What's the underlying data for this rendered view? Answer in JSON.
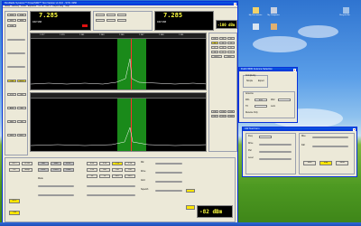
{
  "main_window": {
    "title": "FlexRadio Systems™ PowerSDR™ Text Version v1.19.0 - SVN: 1950",
    "menu": [
      "Setup",
      "Memory",
      "Wave",
      "Equalizer",
      "XVTR",
      "CW X",
      "Report Bug",
      "Help"
    ],
    "vfo_a": {
      "freq": "7.285",
      "freq_small": "000",
      "mode": "40M SSB"
    },
    "vfo_b": {
      "freq": "7.285",
      "freq_small": "000",
      "mode": "40M SSB"
    },
    "signal": "-100 dBm",
    "signal2": "-82 dBm",
    "ticks": [
      "7.277",
      "7.279",
      "7.281",
      "7.283",
      "7.285",
      "7.287",
      "7.289",
      "7.291",
      "7.293"
    ],
    "buttons_left": [
      "Start",
      "Stop",
      "Rec",
      "Mon",
      "Play",
      "TUN",
      "MOX",
      "VOX",
      "NR",
      "ANF",
      "NB",
      "NB2",
      "SR",
      "BIN",
      "MUT",
      "SPLT",
      "CPDR",
      "DX",
      "Sleep",
      "AGC"
    ],
    "buttons_right": [
      "160",
      "80",
      "60",
      "40",
      "30",
      "20",
      "17",
      "15",
      "12",
      "10",
      "6",
      "2",
      "WWV",
      "GEN"
    ],
    "mode_buttons": [
      "LSB",
      "USB",
      "DSB",
      "CWL",
      "CWU",
      "FMN",
      "AM",
      "SAM",
      "SPEC",
      "DIGL",
      "DIGU",
      "DRM"
    ],
    "filter_buttons": [
      "6.0k",
      "4.0k",
      "2.6k",
      "2.1k",
      "1.0k",
      "500",
      "250",
      "100",
      "50",
      "25",
      "Var 1",
      "Var 2"
    ],
    "bottom_labels": [
      "Mode",
      "Band",
      "Filter",
      "Mic",
      "Drive",
      "AGC",
      "Squelch"
    ]
  },
  "antenna_window": {
    "title": "FLEX-5000 Antenna Selection",
    "group": "Complexity",
    "options": [
      "Simple",
      "Expert"
    ],
    "labels": [
      "Antenna",
      "Receive Only",
      "RX1",
      "TX",
      "RX2",
      "Lock"
    ],
    "value": "RX1"
  },
  "cw_window": {
    "title": "CW Test Form",
    "labels": [
      "Freq",
      "Drive",
      "Pwr",
      "Level",
      "Rise",
      "Fall"
    ],
    "buttons": [
      "Start",
      "Stop",
      "Send"
    ]
  },
  "desktop_icons": [
    "My Documents",
    "My Computer",
    "My Network",
    "Recycle Bin",
    "PowerSDR",
    "Internet"
  ],
  "colors": {
    "lcd_digits": "#ffff40",
    "pan_band": "#1a8a1a",
    "accent": "#ffe600",
    "titlebar": "#0831d9"
  }
}
